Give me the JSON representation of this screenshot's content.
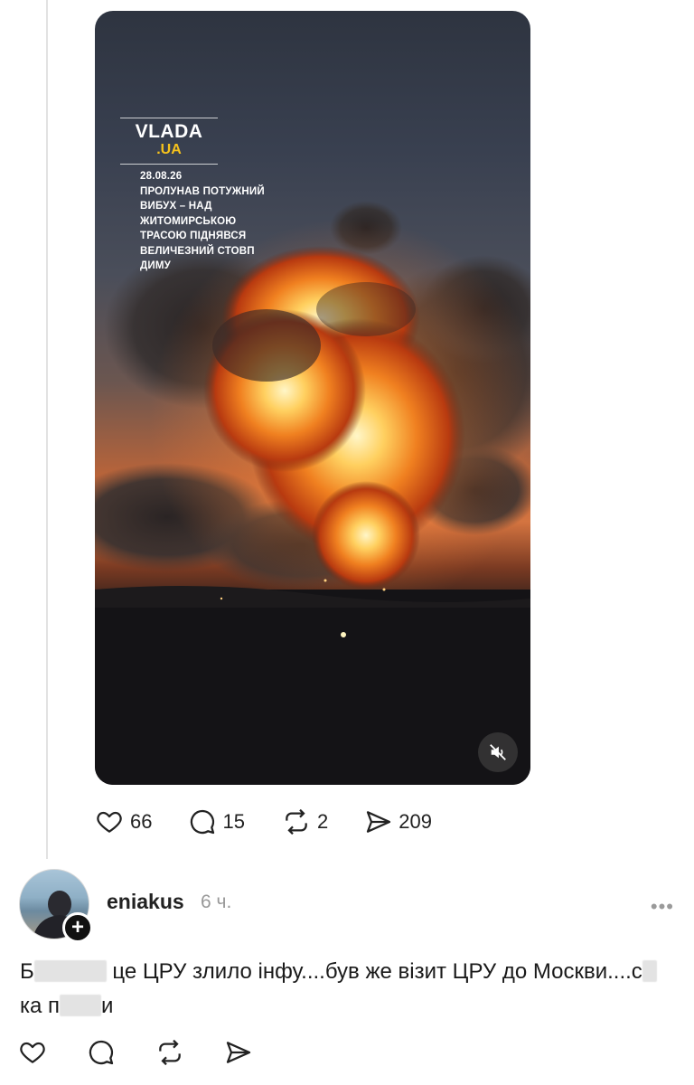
{
  "post": {
    "media": {
      "brand_name": "VLADA",
      "brand_tld": ".UA",
      "date": "28.08.26",
      "headline": "ПРОЛУНАВ ПОТУЖНИЙ ВИБУХ – НАД ЖИТОМИРСЬКОЮ ТРАСОЮ ПІДНЯВСЯ ВЕЛИЧЕЗНИЙ СТОВП ДИМУ",
      "mute_icon": "speaker-muted-icon"
    },
    "stats": {
      "likes": "66",
      "replies": "15",
      "reposts": "2",
      "shares": "209"
    }
  },
  "reply": {
    "username": "eniakus",
    "time": "6 ч.",
    "more": "•••",
    "text_part1": "Б",
    "text_part2": " це ЦРУ злило інфу....був же візит ЦРУ до Москви....с",
    "text_part3": "ка п",
    "text_part4": "и"
  },
  "icons": {
    "like": "heart-icon",
    "reply": "comment-icon",
    "repost": "repost-icon",
    "share": "send-icon"
  },
  "colors": {
    "accent_yellow": "#f6c21c",
    "text": "#222222",
    "muted": "#999999"
  }
}
